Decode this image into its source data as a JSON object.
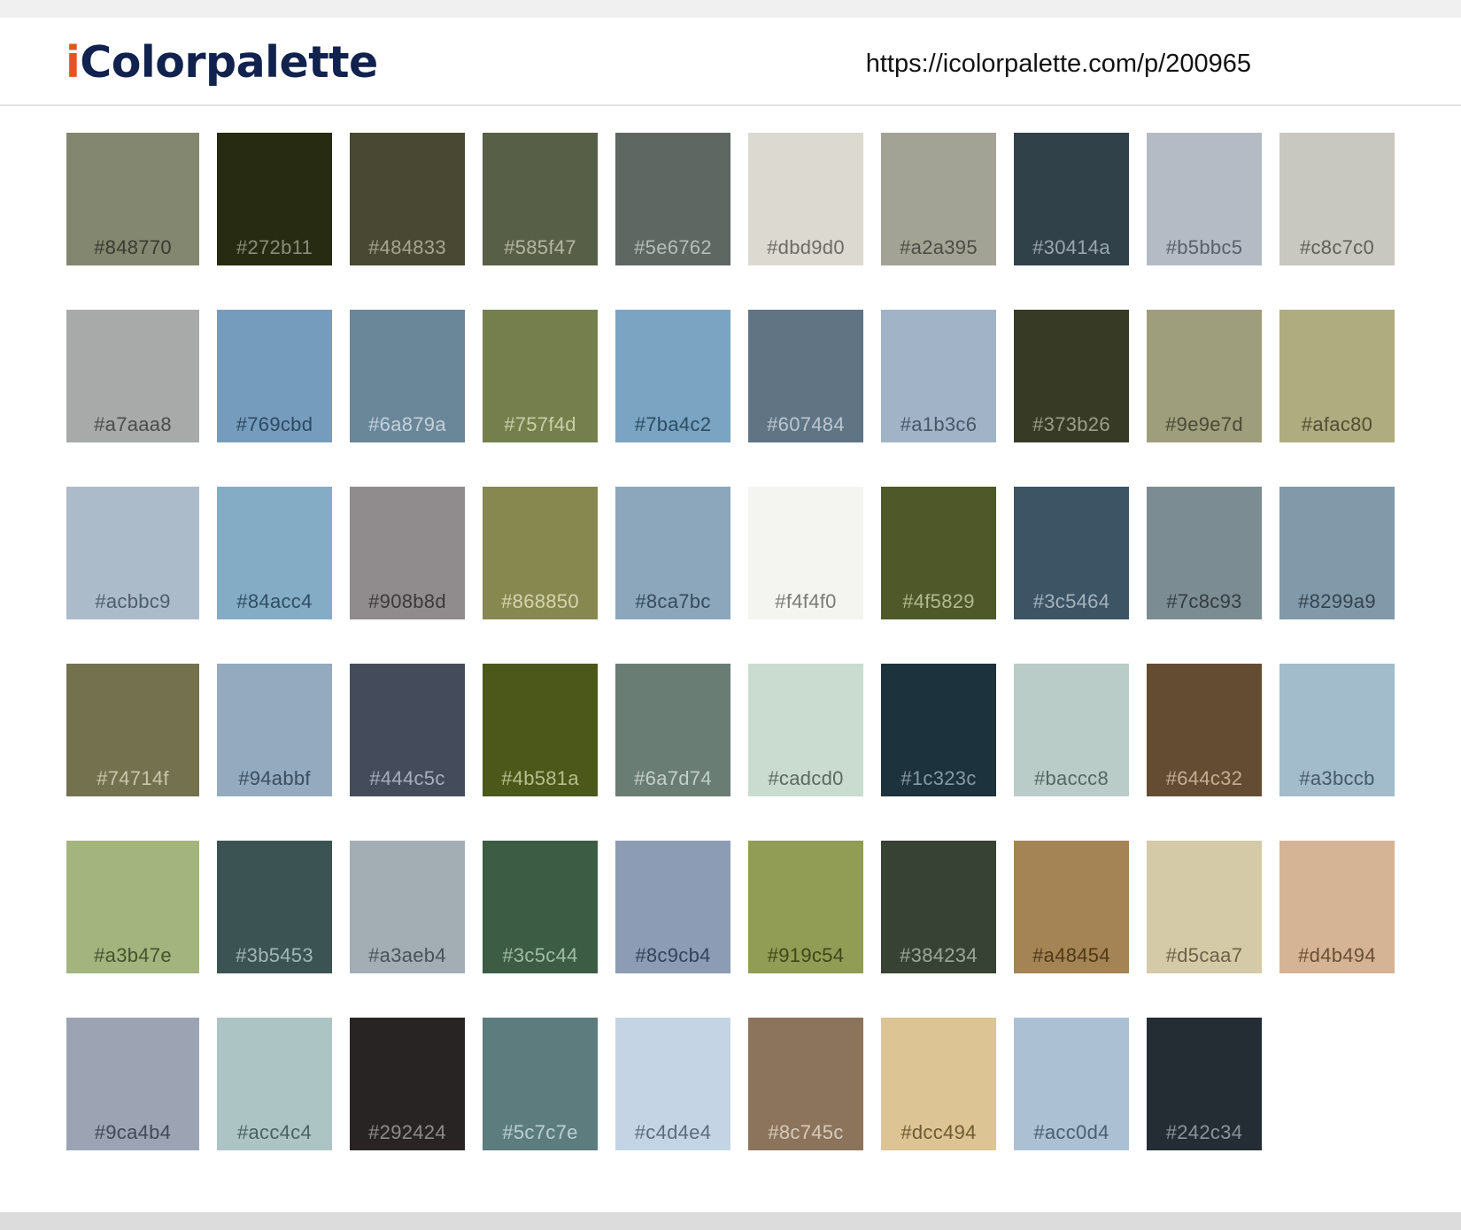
{
  "header": {
    "logo_i": "i",
    "logo_rest": "Colorpalette",
    "url": "https://icolorpalette.com/p/200965"
  },
  "swatches": [
    {
      "label": "#848770",
      "color": "#848770",
      "text_color": "#3a3b30"
    },
    {
      "label": "#272b11",
      "color": "#272b11",
      "text_color": "#8a8d78"
    },
    {
      "label": "#484833",
      "color": "#484833",
      "text_color": "#a6a690"
    },
    {
      "label": "#585f47",
      "color": "#585f47",
      "text_color": "#b2b7a0"
    },
    {
      "label": "#5e6762",
      "color": "#5e6762",
      "text_color": "#b6bdb9"
    },
    {
      "label": "#dbd9d0",
      "color": "#dbd9d0",
      "text_color": "#6d6b63"
    },
    {
      "label": "#a2a395",
      "color": "#a2a395",
      "text_color": "#4c4d43"
    },
    {
      "label": "#30414a",
      "color": "#30414a",
      "text_color": "#9aa6ad"
    },
    {
      "label": "#b5bbc5",
      "color": "#b5bbc5",
      "text_color": "#5a606a"
    },
    {
      "label": "#c8c7c0",
      "color": "#c8c7c0",
      "text_color": "#5f5e58"
    },
    {
      "label": "#a7aaa8",
      "color": "#a7aaa8",
      "text_color": "#4a4c4b"
    },
    {
      "label": "#769cbd",
      "color": "#769cbd",
      "text_color": "#2d4a62"
    },
    {
      "label": "#6a879a",
      "color": "#6a879a",
      "text_color": "#c3d1da"
    },
    {
      "label": "#757f4d",
      "color": "#757f4d",
      "text_color": "#c8cfa8"
    },
    {
      "label": "#7ba4c2",
      "color": "#7ba4c2",
      "text_color": "#2b4c64"
    },
    {
      "label": "#607484",
      "color": "#607484",
      "text_color": "#bcc7d0"
    },
    {
      "label": "#a1b3c6",
      "color": "#a1b3c6",
      "text_color": "#465768"
    },
    {
      "label": "#373b26",
      "color": "#373b26",
      "text_color": "#9b9e88"
    },
    {
      "label": "#9e9e7d",
      "color": "#9e9e7d",
      "text_color": "#4a4a36"
    },
    {
      "label": "#afac80",
      "color": "#afac80",
      "text_color": "#504e33"
    },
    {
      "label": "#acbbc9",
      "color": "#acbbc9",
      "text_color": "#4f5d6a"
    },
    {
      "label": "#84acc4",
      "color": "#84acc4",
      "text_color": "#2f4f63"
    },
    {
      "label": "#908b8d",
      "color": "#908b8d",
      "text_color": "#3d393b"
    },
    {
      "label": "#868850",
      "color": "#868850",
      "text_color": "#d4d5ad"
    },
    {
      "label": "#8ca7bc",
      "color": "#8ca7bc",
      "text_color": "#344b5d"
    },
    {
      "label": "#f4f4f0",
      "color": "#f4f4f0",
      "text_color": "#7a7a76"
    },
    {
      "label": "#4f5829",
      "color": "#4f5829",
      "text_color": "#b2b98f"
    },
    {
      "label": "#3c5464",
      "color": "#3c5464",
      "text_color": "#a3b3be"
    },
    {
      "label": "#7c8c93",
      "color": "#7c8c93",
      "text_color": "#323c41"
    },
    {
      "label": "#8299a9",
      "color": "#8299a9",
      "text_color": "#33444f"
    },
    {
      "label": "#74714f",
      "color": "#74714f",
      "text_color": "#c9c6a9"
    },
    {
      "label": "#94abbf",
      "color": "#94abbf",
      "text_color": "#3a4d5e"
    },
    {
      "label": "#444c5c",
      "color": "#444c5c",
      "text_color": "#a7aebb"
    },
    {
      "label": "#4b581a",
      "color": "#4b581a",
      "text_color": "#b4bf8c"
    },
    {
      "label": "#6a7d74",
      "color": "#6a7d74",
      "text_color": "#c3cfca"
    },
    {
      "label": "#cadcd0",
      "color": "#cadcd0",
      "text_color": "#5a6a60"
    },
    {
      "label": "#1c323c",
      "color": "#1c323c",
      "text_color": "#869aa3"
    },
    {
      "label": "#baccc8",
      "color": "#baccc8",
      "text_color": "#566763"
    },
    {
      "label": "#644c32",
      "color": "#644c32",
      "text_color": "#c2ae98"
    },
    {
      "label": "#a3bccb",
      "color": "#a3bccb",
      "text_color": "#44596a"
    },
    {
      "label": "#a3b47e",
      "color": "#a3b47e",
      "text_color": "#46532b"
    },
    {
      "label": "#3b5453",
      "color": "#3b5453",
      "text_color": "#a1b6b5"
    },
    {
      "label": "#a3aeb4",
      "color": "#a3aeb4",
      "text_color": "#48525a"
    },
    {
      "label": "#3c5c44",
      "color": "#3c5c44",
      "text_color": "#a2bca8"
    },
    {
      "label": "#8c9cb4",
      "color": "#8c9cb4",
      "text_color": "#34435a"
    },
    {
      "label": "#919c54",
      "color": "#919c54",
      "text_color": "#3e4719"
    },
    {
      "label": "#384234",
      "color": "#384234",
      "text_color": "#9da799"
    },
    {
      "label": "#a48454",
      "color": "#a48454",
      "text_color": "#4f3916"
    },
    {
      "label": "#d5caa7",
      "color": "#d5caa7",
      "text_color": "#6b6247"
    },
    {
      "label": "#d4b494",
      "color": "#d4b494",
      "text_color": "#6a4f36"
    },
    {
      "label": "#9ca4b4",
      "color": "#9ca4b4",
      "text_color": "#414958"
    },
    {
      "label": "#acc4c4",
      "color": "#acc4c4",
      "text_color": "#4a6262"
    },
    {
      "label": "#292424",
      "color": "#292424",
      "text_color": "#8f8a8a"
    },
    {
      "label": "#5c7c7e",
      "color": "#5c7c7e",
      "text_color": "#bcd0d1"
    },
    {
      "label": "#c4d4e4",
      "color": "#c4d4e4",
      "text_color": "#5b6c7d"
    },
    {
      "label": "#8c745c",
      "color": "#8c745c",
      "text_color": "#d7c9ba"
    },
    {
      "label": "#dcc494",
      "color": "#dcc494",
      "text_color": "#6f5b32"
    },
    {
      "label": "#acc0d4",
      "color": "#acc0d4",
      "text_color": "#4b5f73"
    },
    {
      "label": "#242c34",
      "color": "#242c34",
      "text_color": "#8a939b"
    }
  ]
}
